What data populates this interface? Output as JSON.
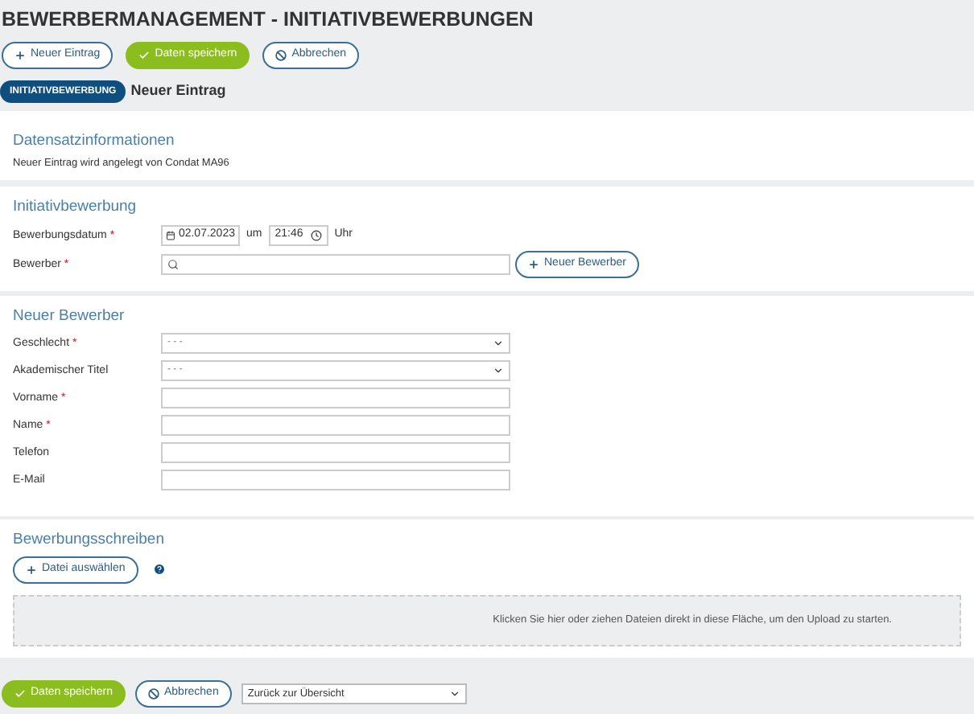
{
  "page_title": "BEWERBERMANAGEMENT - INITIATIVBEWERBUNGEN",
  "toolbar": [
    {
      "label": "Neuer Eintrag",
      "kind": "add"
    },
    {
      "label": "Daten speichern",
      "kind": "save"
    },
    {
      "label": "Abbrechen",
      "kind": "cancel"
    }
  ],
  "required_mark": "*",
  "record": {
    "badge": "INITIATIVBEWERBUNG",
    "title": "Neuer Eintrag"
  },
  "datensatz": {
    "heading": "Datensatzinformationen",
    "text": "Neuer Eintrag wird angelegt von Condat MA96"
  },
  "initiativ": {
    "heading": "Initiativbewerbung",
    "date_label": "Bewerbungsdatum",
    "date_required": true,
    "date": "02.07.2023",
    "at": "um",
    "time": "21:46",
    "time_unit": "Uhr",
    "applicant_label": "Bewerber",
    "applicant_required": true,
    "new_applicant_button": "Neuer Bewerber"
  },
  "neuer_bewerber": {
    "heading": "Neuer Bewerber",
    "fields": [
      {
        "label": "Geschlecht",
        "required": true,
        "kind": "select",
        "value": "- - -"
      },
      {
        "label": "Akademischer Titel",
        "required": false,
        "kind": "select",
        "value": "- - -"
      },
      {
        "label": "Vorname",
        "required": true,
        "kind": "text"
      },
      {
        "label": "Name",
        "required": true,
        "kind": "text"
      },
      {
        "label": "Telefon",
        "required": false,
        "kind": "text"
      },
      {
        "label": "E-Mail",
        "required": false,
        "kind": "text"
      }
    ]
  },
  "bewerbungsschreiben": {
    "heading": "Bewerbungsschreiben",
    "file_button": "Datei auswählen",
    "dropzone": "Klicken Sie hier oder ziehen Dateien direkt in diese Fläche, um den Upload zu starten."
  },
  "footer": {
    "buttons": [
      {
        "label": "Daten speichern",
        "kind": "save"
      },
      {
        "label": "Abbrechen",
        "kind": "cancel"
      }
    ],
    "nav_select": "Zurück zur Übersicht"
  }
}
